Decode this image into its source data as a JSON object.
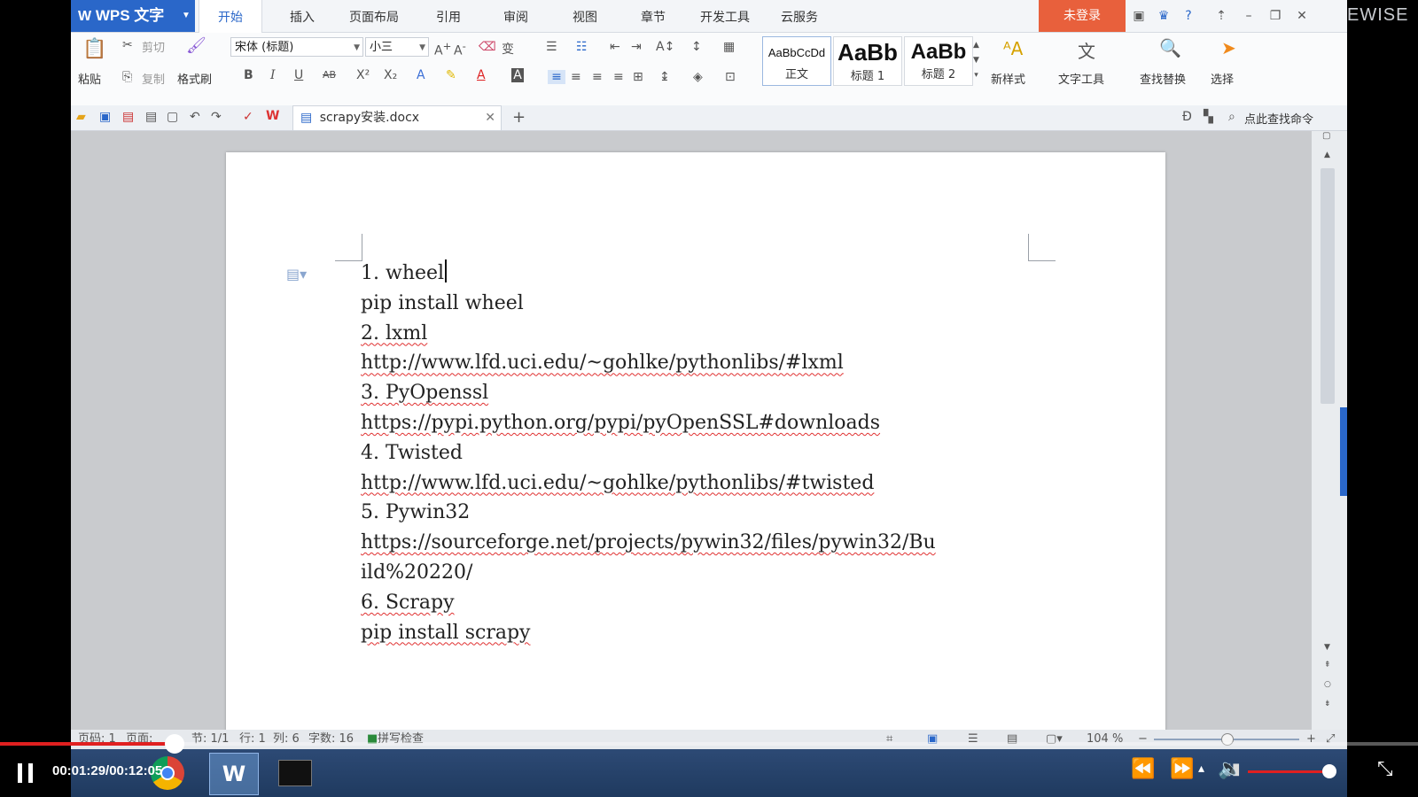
{
  "app": {
    "name": "WPS 文字",
    "menu_tabs": [
      "开始",
      "插入",
      "页面布局",
      "引用",
      "审阅",
      "视图",
      "章节",
      "开发工具",
      "云服务"
    ],
    "active_tab": "开始",
    "login_label": "未登录",
    "brand_text": "EWISE"
  },
  "ribbon": {
    "paste": "粘贴",
    "cut": "剪切",
    "copy": "复制",
    "format_painter": "格式刷",
    "font_name": "宋体 (标题)",
    "font_size": "小三",
    "format_buttons": [
      "B",
      "I",
      "U",
      "AB",
      "X²",
      "X₂"
    ],
    "styles": [
      {
        "preview": "AaBbCcDd",
        "label": "正文"
      },
      {
        "preview": "AaBb",
        "label": "标题 1"
      },
      {
        "preview": "AaBb",
        "label": "标题 2"
      }
    ],
    "new_style": "新样式",
    "text_tools": "文字工具",
    "find_replace": "查找替换",
    "select": "选择"
  },
  "quick_access": {
    "doc_tab": "scrapy安装.docx",
    "search_cmd": "点此查找命令"
  },
  "document": {
    "lines": [
      {
        "text": "1.  wheel",
        "squiggle": false,
        "cursor": true
      },
      {
        "text": "pip install wheel",
        "squiggle": false
      },
      {
        "text": "2.  lxml",
        "squiggle": true
      },
      {
        "text": "http://www.lfd.uci.edu/~gohlke/pythonlibs/#lxml",
        "squiggle": true
      },
      {
        "text": "3.  PyOpenssl",
        "squiggle": true
      },
      {
        "text": "https://pypi.python.org/pypi/pyOpenSSL#downloads",
        "squiggle": true
      },
      {
        "text": "4.  Twisted",
        "squiggle": false
      },
      {
        "text": "http://www.lfd.uci.edu/~gohlke/pythonlibs/#twisted",
        "squiggle": true
      },
      {
        "text": "5.  Pywin32",
        "squiggle": false
      },
      {
        "text": "https://sourceforge.net/projects/pywin32/files/pywin32/Bu",
        "squiggle": true
      },
      {
        "text": "ild%20220/",
        "squiggle": false
      },
      {
        "text": "6.  Scrapy",
        "squiggle": true
      },
      {
        "text": "pip install scrapy",
        "squiggle": true
      }
    ]
  },
  "status_bar": {
    "page_no": "页码: 1",
    "pages": "页面:",
    "section": "节: 1/1",
    "row": "行: 1",
    "col": "列: 6",
    "word_count": "字数: 16",
    "spell_check": "拼写检查",
    "zoom": "104 %"
  },
  "video": {
    "time": "00:01:29/00:12:05",
    "progress": 0.123
  },
  "colors": {
    "accent": "#2a67c9",
    "login": "#e8603c",
    "progress": "#e02020"
  }
}
